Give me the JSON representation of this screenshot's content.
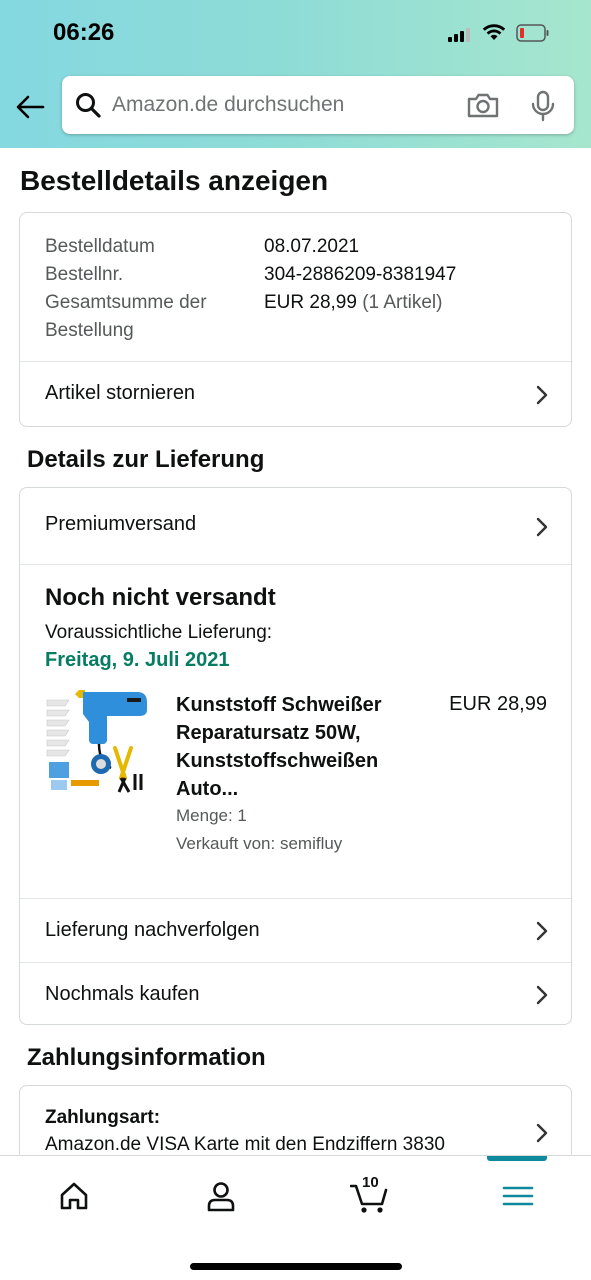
{
  "status_bar": {
    "time": "06:26"
  },
  "search": {
    "placeholder": "Amazon.de durchsuchen"
  },
  "page": {
    "title": "Bestelldetails anzeigen"
  },
  "order_summary": {
    "date_label": "Bestelldatum",
    "date_value": "08.07.2021",
    "number_label": "Bestellnr.",
    "number_value": "304-2886209-8381947",
    "total_label_line1": "Gesamtsumme der",
    "total_label_line2": "Bestellung",
    "total_value": "EUR 28,99",
    "total_items": "(1 Artikel)",
    "cancel_label": "Artikel stornieren"
  },
  "delivery": {
    "section_title": "Details zur Lieferung",
    "shipping_method": "Premiumversand",
    "status": "Noch nicht versandt",
    "expected_label": "Voraussichtliche Lieferung:",
    "expected_date": "Freitag, 9. Juli 2021",
    "product": {
      "title": "Kunststoff Schweißer Reparatursatz 50W, Kunststoffschweißen Auto...",
      "price": "EUR 28,99",
      "quantity": "Menge: 1",
      "seller": "Verkauft von: semifluy"
    },
    "track_label": "Lieferung nachverfolgen",
    "rebuy_label": "Nochmals kaufen"
  },
  "payment": {
    "section_title": "Zahlungsinformation",
    "type_label": "Zahlungsart:",
    "type_value": "Amazon.de VISA Karte mit den Endziffern 3830"
  },
  "bottom_nav": {
    "cart_count": "10"
  },
  "colors": {
    "accent": "#067d62",
    "nav_indicator": "#0f8a9c",
    "header_gradient_start": "#84d8e0",
    "header_gradient_end": "#a6e6ce"
  }
}
